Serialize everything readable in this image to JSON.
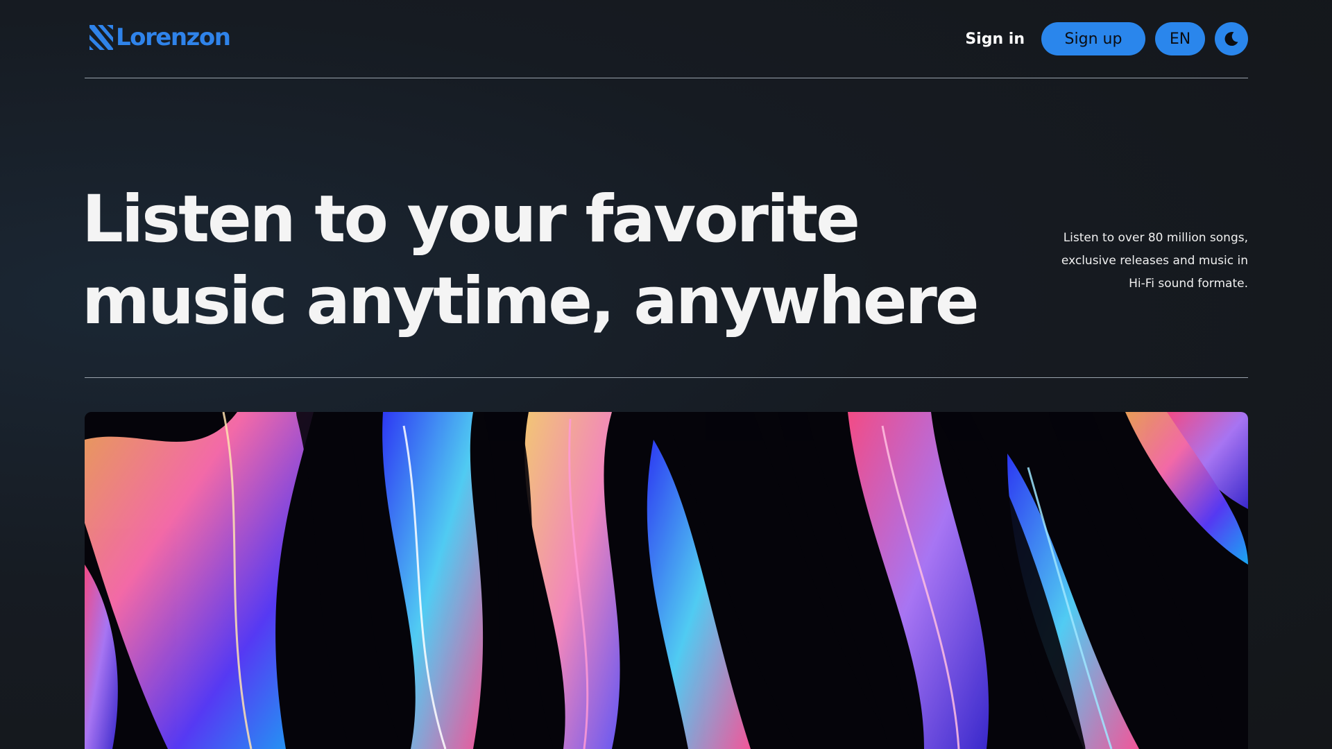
{
  "brand": {
    "name": "Lorenzon",
    "icon": "lorenzon-logo-icon",
    "color": "#2f83ea"
  },
  "nav": {
    "sign_in": "Sign in",
    "sign_up": "Sign up",
    "language": "EN",
    "theme_icon": "moon-icon",
    "button_color": "#2a86ec"
  },
  "hero": {
    "title": "Listen to your favorite music anytime, anywhere",
    "subtitle": "Listen to over 80 million songs, exclusive releases and music in Hi-Fi sound formate.",
    "image": "abstract-fluid-art-image"
  }
}
